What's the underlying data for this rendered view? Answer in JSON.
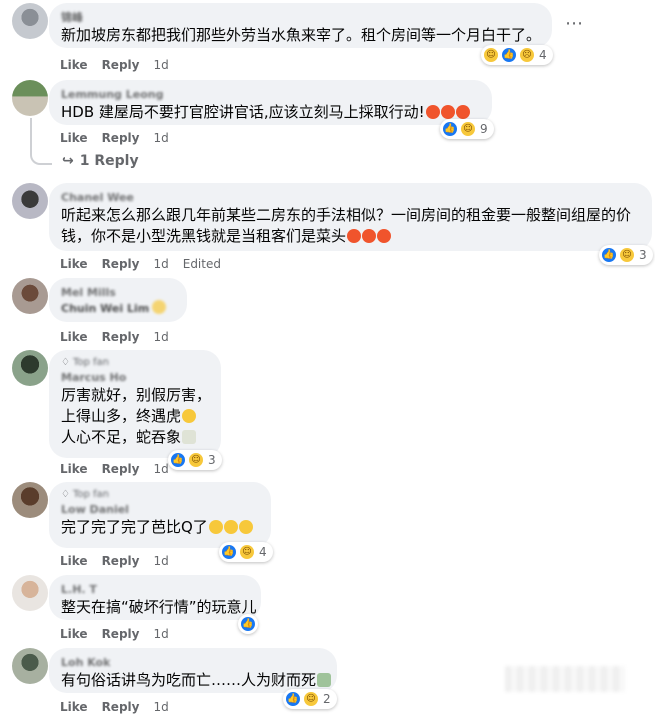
{
  "more_icon": "⋯",
  "actions": {
    "like": "Like",
    "reply": "Reply"
  },
  "comments": [
    {
      "author": "锦峰",
      "badge": "",
      "lines": [
        "新加坡房东都把我们那些外劳当水魚来宰了。租个房间等一个月白干了。"
      ],
      "time": "1d",
      "edited": "",
      "reactions": [
        "haha",
        "like",
        "sad"
      ],
      "reaction_count": "4",
      "reply_count_label": ""
    },
    {
      "author": "Lemmung Leong",
      "badge": "",
      "lines": [
        "HDB 建屋局不要打官腔讲官话,应该立刻马上採取行动!"
      ],
      "time": "1d",
      "edited": "",
      "reactions": [
        "like",
        "haha"
      ],
      "reaction_count": "9",
      "reply_count_label": "1 Reply"
    },
    {
      "author": "Chanel Wee",
      "badge": "",
      "lines": [
        "听起来怎么那么跟几年前某些二房东的手法相似？一间房间的租金要一般整间组屋的价",
        "钱，你不是小型洗黑钱就是当租客们是菜头"
      ],
      "time": "1d",
      "edited": "Edited",
      "reactions": [
        "like",
        "haha"
      ],
      "reaction_count": "3",
      "reply_count_label": ""
    },
    {
      "author": "Mel Mills",
      "badge": "",
      "lines": [
        "Chuin Wei Lim"
      ],
      "time": "1d",
      "edited": "",
      "reactions": [],
      "reaction_count": "",
      "reply_count_label": ""
    },
    {
      "author": "Marcus Ho",
      "badge": "Top fan",
      "lines": [
        "厉害就好，别假厉害，",
        "上得山多，终遇虎",
        "人心不足，蛇吞象"
      ],
      "time": "1d",
      "edited": "",
      "reactions": [
        "like",
        "haha"
      ],
      "reaction_count": "3",
      "reply_count_label": ""
    },
    {
      "author": "Low Daniel",
      "badge": "Top fan",
      "lines": [
        "完了完了完了芭比Q了"
      ],
      "time": "1d",
      "edited": "",
      "reactions": [
        "like",
        "haha"
      ],
      "reaction_count": "4",
      "reply_count_label": ""
    },
    {
      "author": "L.H. T",
      "badge": "",
      "lines": [
        "整天在搞“破坏行情”的玩意儿"
      ],
      "time": "1d",
      "edited": "",
      "reactions": [
        "like"
      ],
      "reaction_count": "",
      "reply_count_label": ""
    },
    {
      "author": "Loh Kok",
      "badge": "",
      "lines": [
        "有句俗话讲鸟为吃而亡……人为财而死"
      ],
      "time": "1d",
      "edited": "",
      "reactions": [
        "like",
        "haha"
      ],
      "reaction_count": "2",
      "reply_count_label": ""
    }
  ]
}
